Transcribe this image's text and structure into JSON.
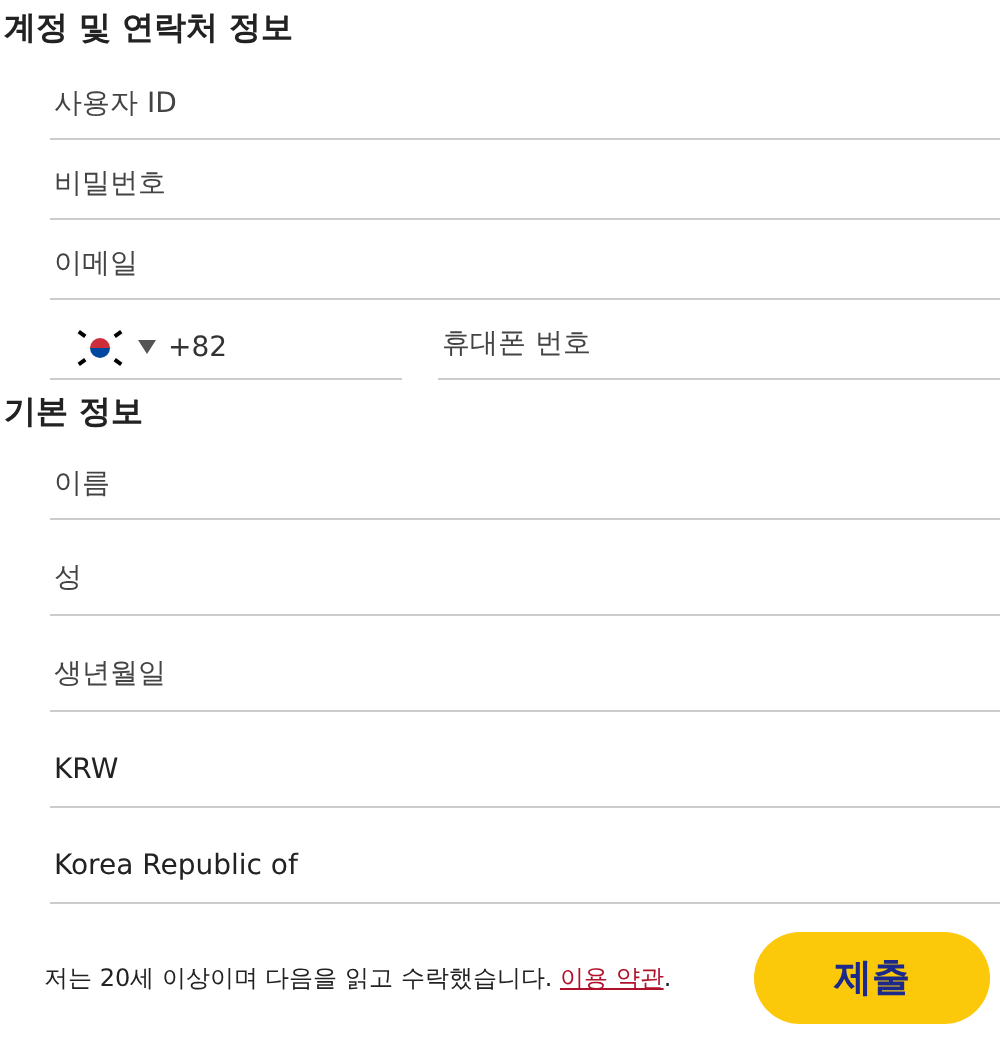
{
  "sections": [
    {
      "title": "계정 및 연락처 정보",
      "fields": [
        {
          "kind": "text",
          "placeholder": "사용자 ID"
        },
        {
          "kind": "text",
          "placeholder": "비밀번호"
        },
        {
          "kind": "text",
          "placeholder": "이메일"
        },
        {
          "kind": "phone",
          "country_code": "+82",
          "placeholder": "휴대폰 번호"
        }
      ]
    },
    {
      "title": "기본 정보",
      "fields": [
        {
          "kind": "text",
          "placeholder": "이름"
        },
        {
          "kind": "text",
          "placeholder": "성"
        },
        {
          "kind": "text",
          "placeholder": "생년월일"
        },
        {
          "kind": "text",
          "value": "KRW"
        },
        {
          "kind": "text",
          "value": "Korea Republic of"
        }
      ]
    }
  ],
  "terms": {
    "text": "저는 20세 이상이며 다음을 읽고 수락했습니다. ",
    "link": "이용 약관",
    "after": "."
  },
  "submit": "제출"
}
